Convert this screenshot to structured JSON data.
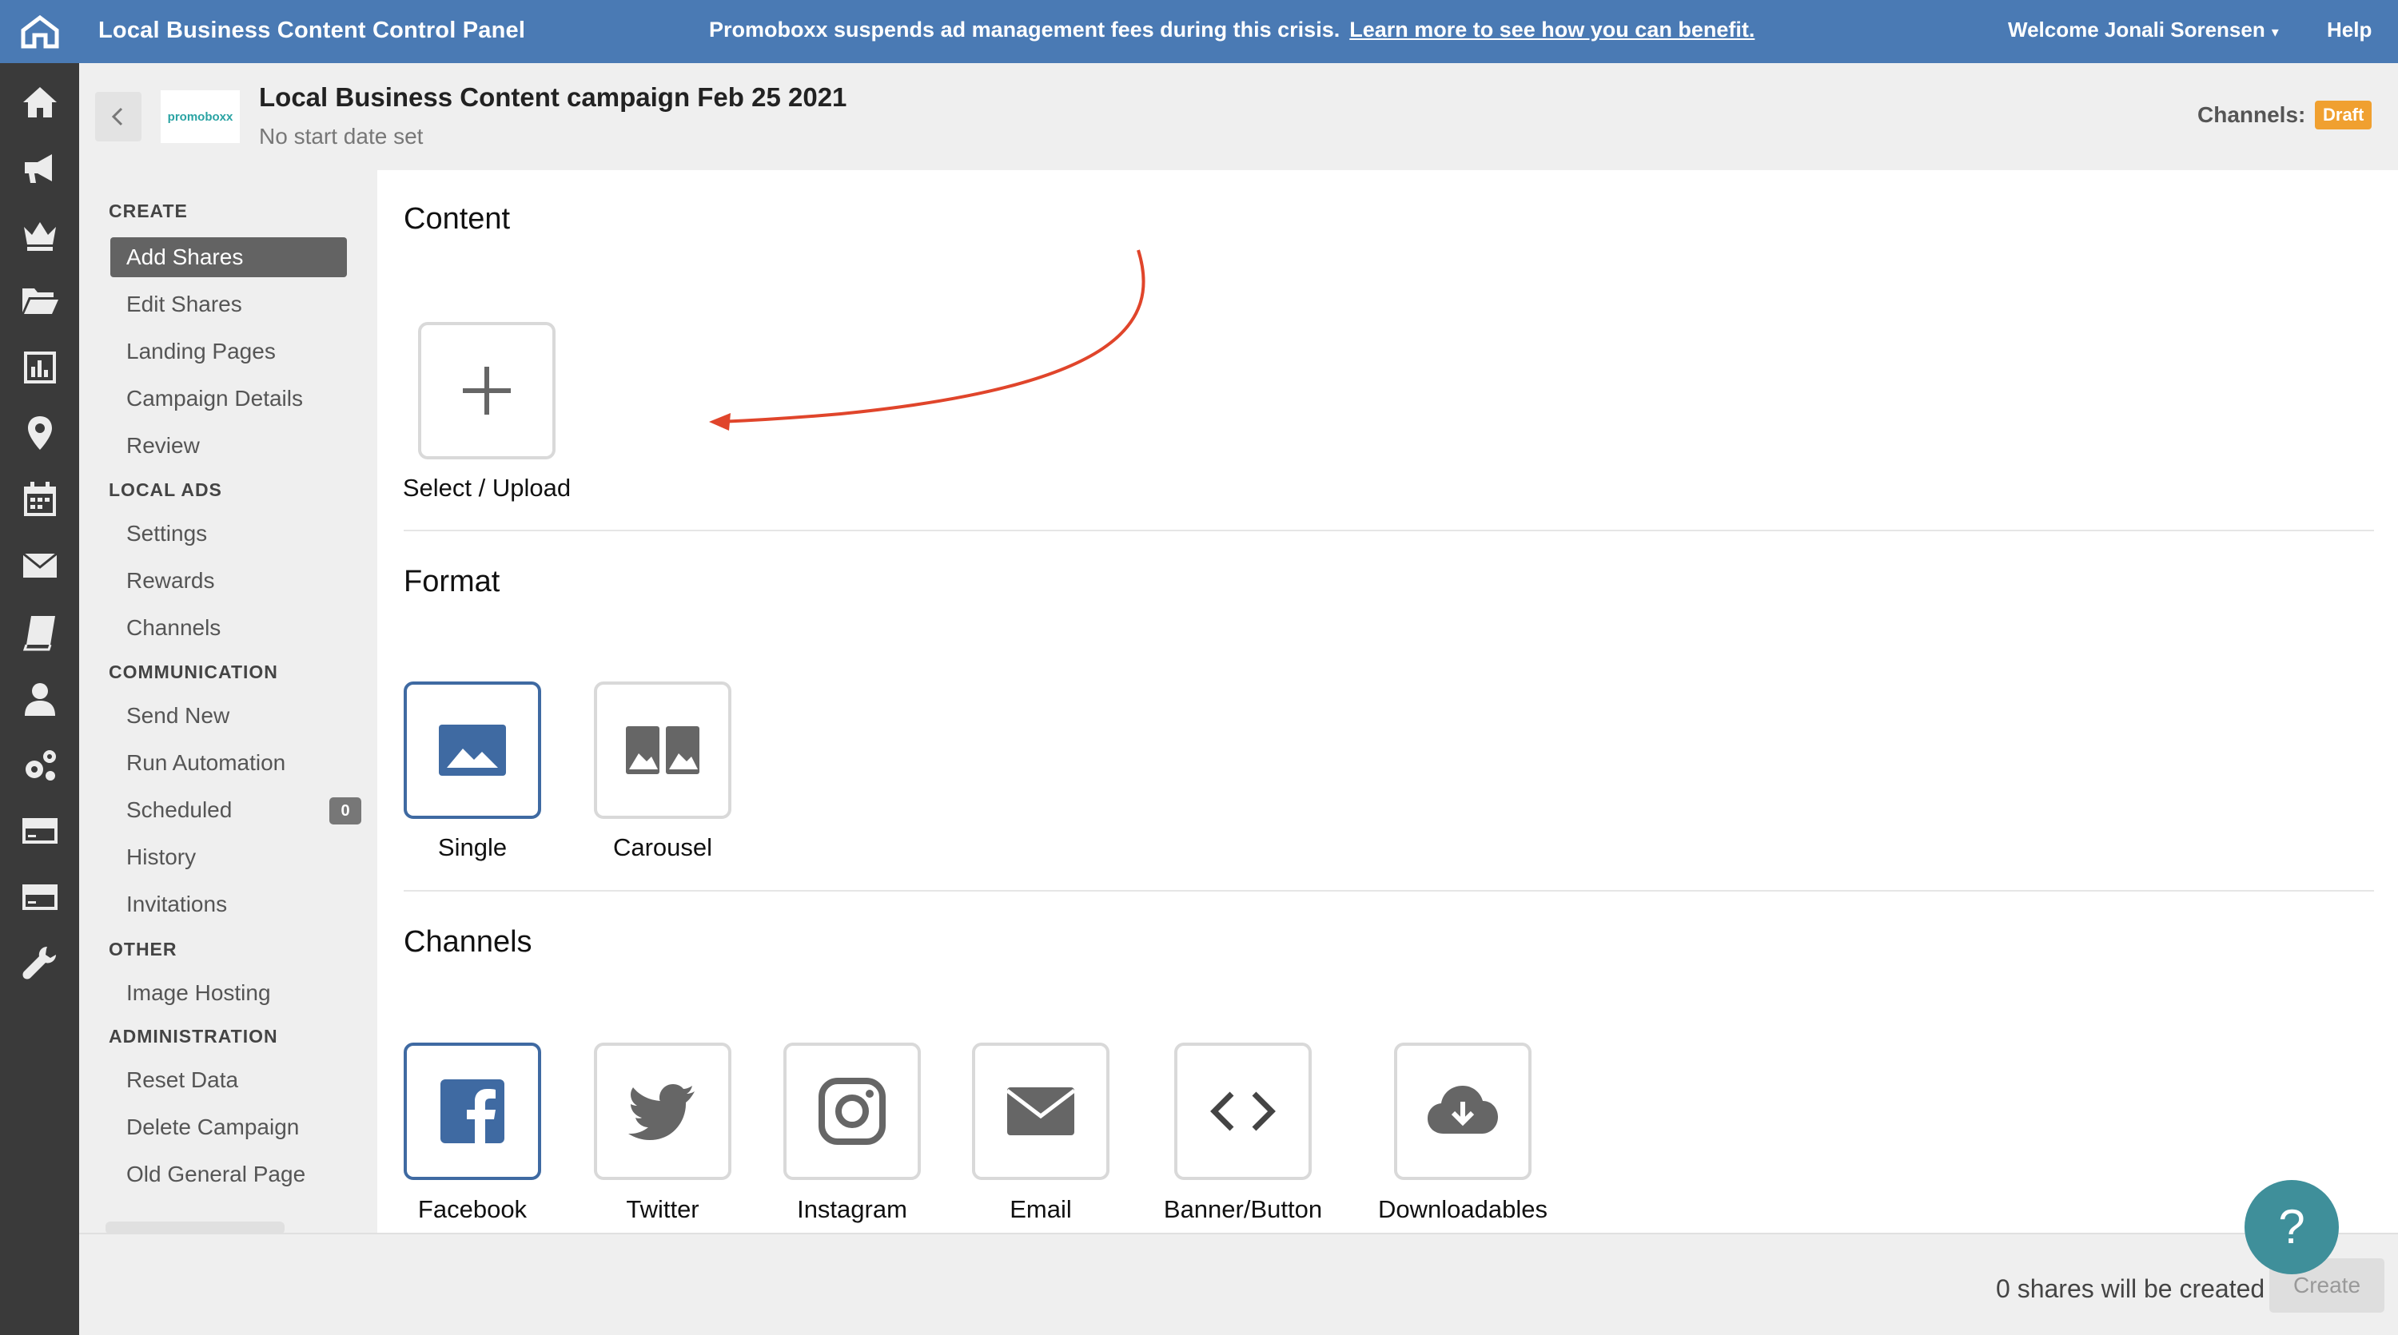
{
  "topbar": {
    "app_title": "Local Business Content Control Panel",
    "notice": "Promoboxx suspends ad management fees during this crisis.",
    "notice_link": "Learn more to see how you can benefit.",
    "welcome": "Welcome Jonali Sorensen",
    "help": "Help"
  },
  "campaign": {
    "logo_text": "promoboxx",
    "title": "Local Business Content campaign Feb 25 2021",
    "subtitle": "No start date set",
    "channels_label": "Channels:",
    "status_badge": "Draft"
  },
  "sidenav": {
    "sections": [
      {
        "title": "CREATE",
        "items": [
          "Add Shares",
          "Edit Shares",
          "Landing Pages",
          "Campaign Details",
          "Review"
        ]
      },
      {
        "title": "LOCAL ADS",
        "items": [
          "Settings",
          "Rewards",
          "Channels"
        ]
      },
      {
        "title": "COMMUNICATION",
        "items": [
          "Send New",
          "Run Automation",
          "Scheduled",
          "History",
          "Invitations"
        ]
      },
      {
        "title": "OTHER",
        "items": [
          "Image Hosting"
        ]
      },
      {
        "title": "ADMINISTRATION",
        "items": [
          "Reset Data",
          "Delete Campaign",
          "Old General Page"
        ]
      }
    ],
    "active_item": "Add Shares",
    "scheduled_count": "0"
  },
  "content": {
    "title": "Content",
    "upload_label": "Select / Upload"
  },
  "format": {
    "title": "Format",
    "options": [
      "Single",
      "Carousel"
    ],
    "selected": "Single"
  },
  "channels": {
    "title": "Channels",
    "options": [
      "Facebook",
      "Twitter",
      "Instagram",
      "Email",
      "Banner/Button",
      "Downloadables"
    ],
    "selected": "Facebook"
  },
  "footer": {
    "shares_text": "0 shares will be created",
    "create_label": "Create"
  },
  "help_bubble": "?",
  "colors": {
    "brand_blue": "#4a7ab4",
    "selected_border": "#3f6aa2",
    "draft_orange": "#f0a030",
    "annotation_red": "#e0452b"
  }
}
